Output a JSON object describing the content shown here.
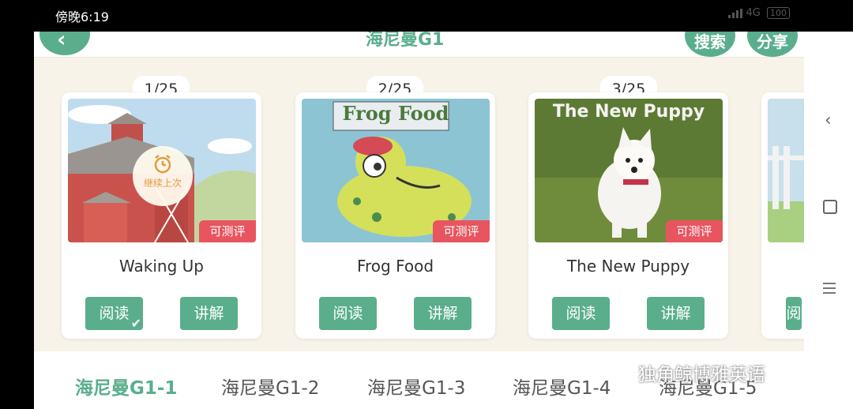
{
  "status_bar": {
    "time": "傍晚6:19",
    "network": "4G",
    "battery": "100"
  },
  "header": {
    "back_icon": "chevron-left-icon",
    "title": "海尼曼G1",
    "search_label": "搜索",
    "share_label": "分享"
  },
  "books": [
    {
      "index": "1/25",
      "title": "Waking Up",
      "tag": "可测评",
      "read_label": "阅读",
      "explain_label": "讲解",
      "resume_label": "继续上次",
      "resume_icon": "alarm-clock-icon",
      "read_checked": true
    },
    {
      "index": "2/25",
      "title": "Frog Food",
      "cover_title": "Frog Food",
      "tag": "可测评",
      "read_label": "阅读",
      "explain_label": "讲解"
    },
    {
      "index": "3/25",
      "title": "The New Puppy",
      "cover_title": "The New Puppy",
      "tag": "可测评",
      "read_label": "阅读",
      "explain_label": "讲解"
    },
    {
      "read_label": "阅"
    }
  ],
  "tabs": [
    {
      "label": "海尼曼G1-1",
      "active": true
    },
    {
      "label": "海尼曼G1-2"
    },
    {
      "label": "海尼曼G1-3"
    },
    {
      "label": "海尼曼G1-4"
    },
    {
      "label": "海尼曼G1-5"
    }
  ],
  "watermark": "独角鲸博雅英语",
  "colors": {
    "accent": "#5aae8c",
    "tag_red": "#e8555f",
    "background": "#f7f3e8"
  }
}
